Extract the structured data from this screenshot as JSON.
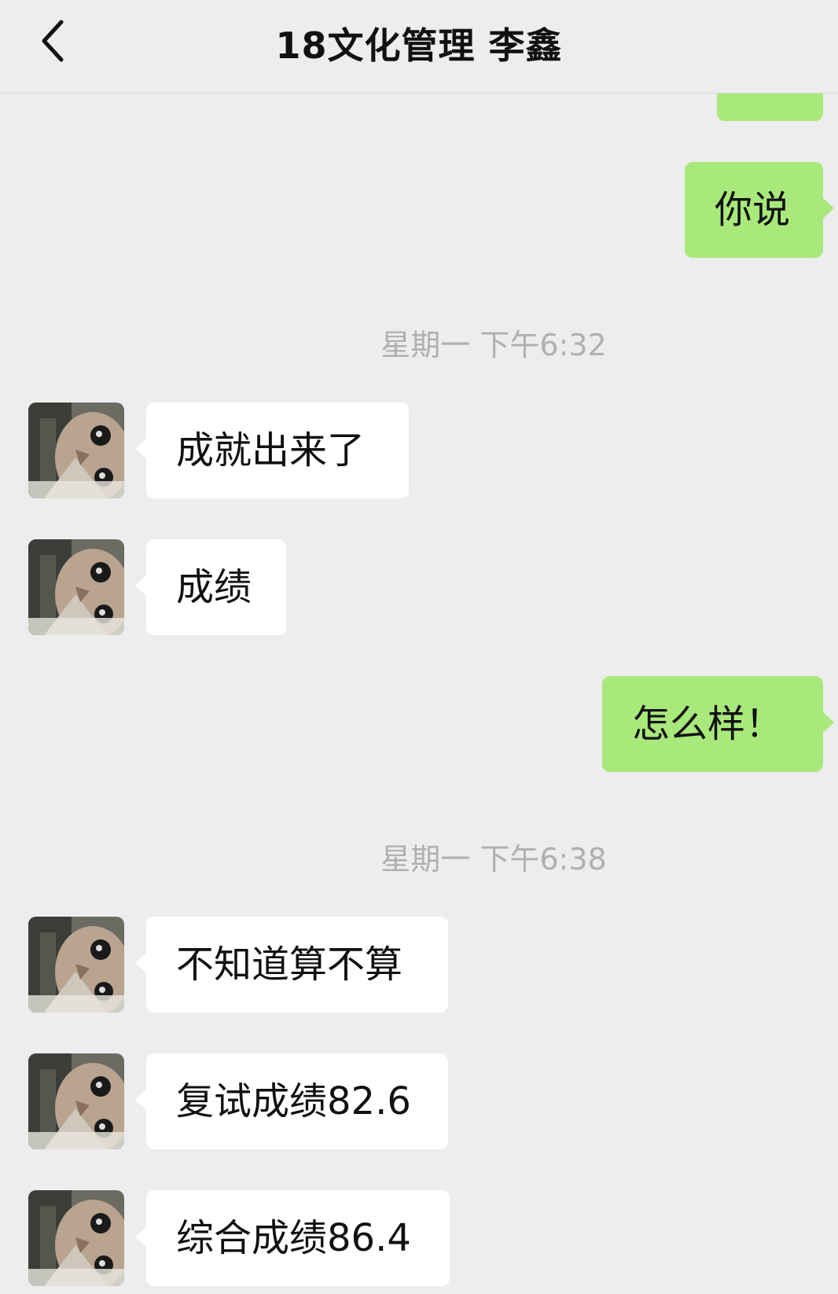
{
  "header": {
    "title": "18文化管理 李鑫",
    "back_icon": "chevron-left-icon"
  },
  "messages": [
    {
      "sender": "me",
      "text": "你说"
    },
    {
      "type": "timestamp",
      "text": "星期一 下午6:32"
    },
    {
      "sender": "contact",
      "text": "成就出来了"
    },
    {
      "sender": "contact",
      "text": "成绩"
    },
    {
      "sender": "me",
      "text": "怎么样！"
    },
    {
      "type": "timestamp",
      "text": "星期一 下午6:38"
    },
    {
      "sender": "contact",
      "text": "不知道算不算"
    },
    {
      "sender": "contact",
      "text": "复试成绩82.6"
    },
    {
      "sender": "contact",
      "text": "综合成绩86.4"
    }
  ],
  "colors": {
    "background": "#ededed",
    "my_bubble": "#a9e97c",
    "contact_bubble": "#ffffff",
    "timestamp_text": "#b0b0b0"
  },
  "avatar_icon": "cat-photo-avatar"
}
